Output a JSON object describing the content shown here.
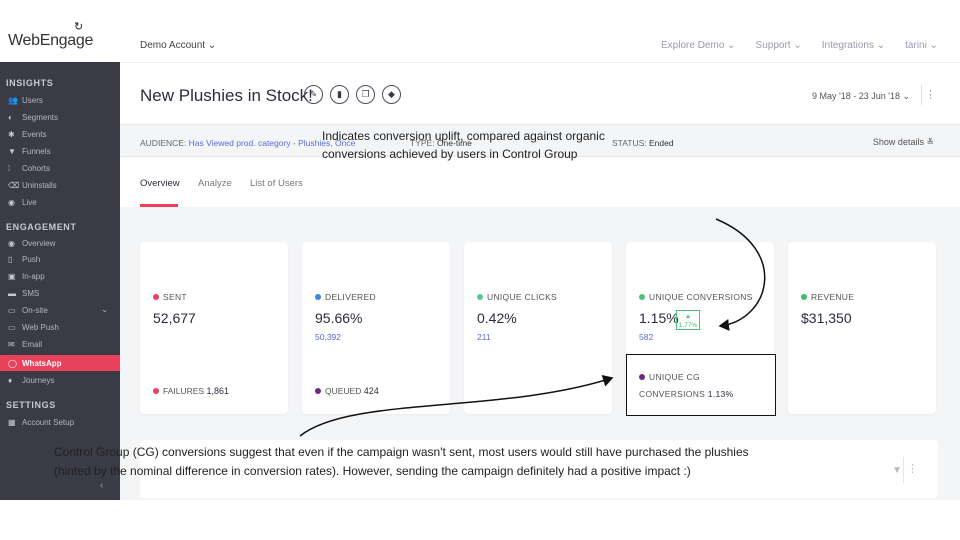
{
  "brand": {
    "logo_text": "WebEngage"
  },
  "topbar": {
    "account": "Demo Account ⌄",
    "nav": [
      "Explore Demo ⌄",
      "Support ⌄",
      "Integrations ⌄",
      "tarini ⌄"
    ]
  },
  "sidebar": {
    "sections": {
      "insights": "INSIGHTS",
      "engagement": "ENGAGEMENT",
      "settings": "SETTINGS"
    },
    "insights": [
      {
        "label": "Users",
        "icon": "users-icon"
      },
      {
        "label": "Segments",
        "icon": "segments-icon"
      },
      {
        "label": "Events",
        "icon": "events-icon"
      },
      {
        "label": "Funnels",
        "icon": "funnels-icon"
      },
      {
        "label": "Cohorts",
        "icon": "cohorts-icon"
      },
      {
        "label": "Uninstalls",
        "icon": "uninstalls-icon"
      },
      {
        "label": "Live",
        "icon": "live-icon"
      }
    ],
    "engagement": [
      {
        "label": "Overview",
        "icon": "eye-icon"
      },
      {
        "label": "Push",
        "icon": "push-icon"
      },
      {
        "label": "In-app",
        "icon": "in-app-icon"
      },
      {
        "label": "SMS",
        "icon": "sms-icon"
      },
      {
        "label": "On-site",
        "icon": "on-site-icon"
      },
      {
        "label": "Web Push",
        "icon": "web-push-icon"
      },
      {
        "label": "Email",
        "icon": "email-icon"
      },
      {
        "label": "WhatsApp",
        "icon": "whatsapp-icon"
      },
      {
        "label": "Journeys",
        "icon": "journeys-icon"
      }
    ],
    "settings": [
      {
        "label": "Account Setup",
        "icon": "grid-icon"
      }
    ],
    "collapse": "‹"
  },
  "campaign": {
    "title": "New Plushies in Stock!",
    "date_range": "9 May '18 - 23 Jun '18 ⌄",
    "more": "⋮"
  },
  "info": {
    "audience_key": "AUDIENCE:",
    "audience_value": "Has Viewed prod. category - Plushies, Once",
    "type_key": "TYPE:",
    "type_value": "One-time",
    "status_key": "STATUS:",
    "status_value": "Ended",
    "show_details": "Show details ≚"
  },
  "tabs": [
    "Overview",
    "Analyze",
    "List of Users"
  ],
  "colors": {
    "accent": "#e9405b",
    "sent": "#e9405b",
    "delivered": "#3a86e0",
    "clicks": "#59c98b",
    "conversions": "#4cc07a",
    "revenue": "#3fb96a",
    "cg": "#6b2c7e",
    "link": "#5c6bd6"
  },
  "cards": [
    {
      "label": "SENT",
      "value": "52,677",
      "sub": "",
      "footer_label": "FAILURES",
      "footer_value": "1,861"
    },
    {
      "label": "DELIVERED",
      "value": "95.66%",
      "sub": "50,392",
      "footer_label": "QUEUED",
      "footer_value": "424"
    },
    {
      "label": "UNIQUE CLICKS",
      "value": "0.42%",
      "sub": "211",
      "footer_label": "",
      "footer_value": ""
    },
    {
      "label": "UNIQUE CONVERSIONS",
      "value": "1.15%",
      "sub": "582",
      "uplift_arrow": "▲",
      "uplift": "1.77%"
    },
    {
      "label": "REVENUE",
      "value": "$31,350",
      "sub": ""
    }
  ],
  "cg": {
    "line1": "UNIQUE CG",
    "line2": "CONVERSIONS",
    "value": "1.13%"
  },
  "annotations": {
    "uplift_line1": "Indicates conversion uplift, compared against organic",
    "uplift_line2": "conversions achieved by users in Control Group",
    "cg_line1": "Control Group (CG) conversions suggest that even if the campaign wasn't sent, most users would still have purchased the plushies",
    "cg_line2": "(hinted by the nominal difference in conversion rates). However, sending the campaign definitely had a positive impact :)"
  }
}
